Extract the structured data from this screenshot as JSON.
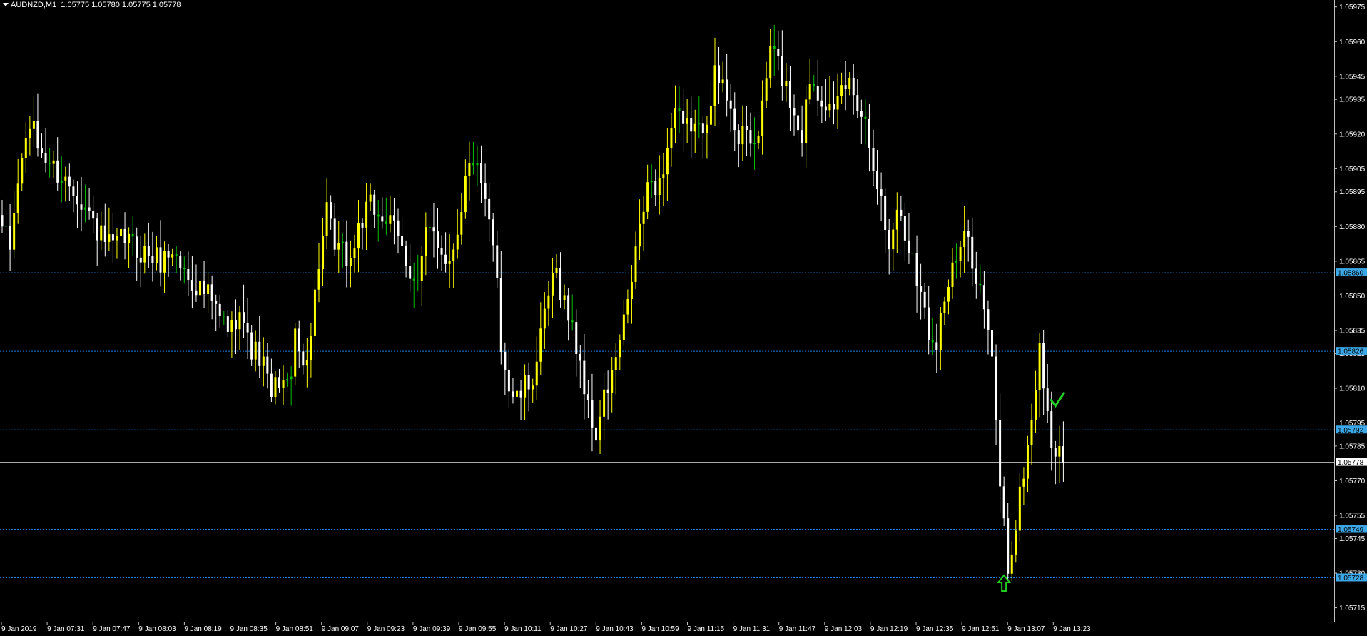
{
  "header": {
    "symbol": "AUDNZD,M1",
    "ohlc": "1.05775 1.05780 1.05775 1.05778"
  },
  "colors": {
    "background": "#000000",
    "bull": "#ffff00",
    "bear": "#ffffff",
    "doji": "#00c000",
    "axis": "#c0c0c0",
    "level_line": "#1e90ff",
    "level_tag": "#3ba7e6",
    "bid_line": "#c0c0c0",
    "annotation": "#22cc22"
  },
  "chart_data": {
    "type": "candlestick",
    "title": "AUDNZD,M1",
    "ylim": [
      1.05709,
      1.05978
    ],
    "y_ticks": [
      "1.05975",
      "1.05960",
      "1.05945",
      "1.05935",
      "1.05920",
      "1.05905",
      "1.05895",
      "1.05880",
      "1.05865",
      "1.05850",
      "1.05835",
      "1.05825",
      "1.05810",
      "1.05795",
      "1.05785",
      "1.05770",
      "1.05755",
      "1.05745",
      "1.05730",
      "1.05715"
    ],
    "x_ticks": [
      "9 Jan 2019",
      "9 Jan 07:31",
      "9 Jan 07:47",
      "9 Jan 08:03",
      "9 Jan 08:19",
      "9 Jan 08:35",
      "9 Jan 08:51",
      "9 Jan 09:07",
      "9 Jan 09:23",
      "9 Jan 09:39",
      "9 Jan 09:55",
      "9 Jan 10:11",
      "9 Jan 10:27",
      "9 Jan 10:43",
      "9 Jan 10:59",
      "9 Jan 11:15",
      "9 Jan 11:31",
      "9 Jan 11:47",
      "9 Jan 12:03",
      "9 Jan 12:19",
      "9 Jan 12:35",
      "9 Jan 12:51",
      "9 Jan 13:07",
      "9 Jan 13:23"
    ],
    "levels": [
      {
        "value": 1.0586,
        "label": "1.05860"
      },
      {
        "value": 1.05826,
        "label": "1.05826"
      },
      {
        "value": 1.05792,
        "label": "1.05792"
      },
      {
        "value": 1.05749,
        "label": "1.05749"
      },
      {
        "value": 1.05728,
        "label": "1.05728"
      }
    ],
    "bid": {
      "value": 1.05778,
      "label": "1.05778"
    },
    "close_path": [
      [
        0,
        1.0588
      ],
      [
        2,
        1.0587
      ],
      [
        4,
        1.059
      ],
      [
        7,
        1.05925
      ],
      [
        9,
        1.05915
      ],
      [
        11,
        1.0591
      ],
      [
        13,
        1.05905
      ],
      [
        16,
        1.059
      ],
      [
        19,
        1.05895
      ],
      [
        22,
        1.05885
      ],
      [
        25,
        1.05875
      ],
      [
        28,
        1.0587
      ],
      [
        31,
        1.05875
      ],
      [
        34,
        1.0587
      ],
      [
        37,
        1.05868
      ],
      [
        40,
        1.05865
      ],
      [
        43,
        1.0587
      ],
      [
        46,
        1.0586
      ],
      [
        49,
        1.05855
      ],
      [
        52,
        1.0585
      ],
      [
        55,
        1.0584
      ],
      [
        58,
        1.05835
      ],
      [
        60,
        1.05848
      ],
      [
        62,
        1.0583
      ],
      [
        64,
        1.05825
      ],
      [
        66,
        1.0582
      ],
      [
        68,
        1.05805
      ],
      [
        70,
        1.05815
      ],
      [
        72,
        1.0581
      ],
      [
        74,
        1.0583
      ],
      [
        76,
        1.0582
      ],
      [
        78,
        1.05835
      ],
      [
        80,
        1.05865
      ],
      [
        82,
        1.05885
      ],
      [
        84,
        1.0587
      ],
      [
        86,
        1.05868
      ],
      [
        88,
        1.05865
      ],
      [
        90,
        1.0588
      ],
      [
        93,
        1.05888
      ],
      [
        96,
        1.05885
      ],
      [
        99,
        1.05878
      ],
      [
        101,
        1.0587
      ],
      [
        103,
        1.05862
      ],
      [
        105,
        1.05855
      ],
      [
        107,
        1.05875
      ],
      [
        109,
        1.05878
      ],
      [
        111,
        1.0587
      ],
      [
        113,
        1.05865
      ],
      [
        115,
        1.0588
      ],
      [
        117,
        1.059
      ],
      [
        119,
        1.0591
      ],
      [
        121,
        1.05895
      ],
      [
        123,
        1.0588
      ],
      [
        125,
        1.0586
      ],
      [
        126,
        1.0583
      ],
      [
        128,
        1.0581
      ],
      [
        130,
        1.05805
      ],
      [
        132,
        1.0581
      ],
      [
        134,
        1.05815
      ],
      [
        136,
        1.0583
      ],
      [
        138,
        1.0585
      ],
      [
        140,
        1.0586
      ],
      [
        142,
        1.05848
      ],
      [
        144,
        1.05835
      ],
      [
        146,
        1.05822
      ],
      [
        148,
        1.058
      ],
      [
        150,
        1.0579
      ],
      [
        152,
        1.05805
      ],
      [
        154,
        1.05815
      ],
      [
        156,
        1.0583
      ],
      [
        158,
        1.05845
      ],
      [
        160,
        1.0587
      ],
      [
        162,
        1.05888
      ],
      [
        164,
        1.059
      ],
      [
        166,
        1.05898
      ],
      [
        168,
        1.05915
      ],
      [
        170,
        1.0593
      ],
      [
        172,
        1.0592
      ],
      [
        174,
        1.05925
      ],
      [
        176,
        1.0592
      ],
      [
        178,
        1.0593
      ],
      [
        180,
        1.05945
      ],
      [
        182,
        1.0594
      ],
      [
        184,
        1.05935
      ],
      [
        186,
        1.05915
      ],
      [
        188,
        1.0592
      ],
      [
        190,
        1.05915
      ],
      [
        192,
        1.0593
      ],
      [
        194,
        1.05958
      ],
      [
        196,
        1.0595
      ],
      [
        198,
        1.0594
      ],
      [
        200,
        1.0593
      ],
      [
        202,
        1.0592
      ],
      [
        204,
        1.05945
      ],
      [
        206,
        1.0594
      ],
      [
        208,
        1.05935
      ],
      [
        210,
        1.05925
      ],
      [
        212,
        1.0594
      ],
      [
        214,
        1.05942
      ],
      [
        216,
        1.05935
      ],
      [
        218,
        1.05925
      ],
      [
        220,
        1.0591
      ],
      [
        222,
        1.0589
      ],
      [
        224,
        1.0587
      ],
      [
        226,
        1.0589
      ],
      [
        228,
        1.05875
      ],
      [
        230,
        1.0587
      ],
      [
        232,
        1.0585
      ],
      [
        234,
        1.05835
      ],
      [
        236,
        1.05832
      ],
      [
        238,
        1.0585
      ],
      [
        240,
        1.0586
      ],
      [
        242,
        1.0587
      ],
      [
        244,
        1.05875
      ],
      [
        246,
        1.0586
      ],
      [
        248,
        1.05845
      ],
      [
        250,
        1.0582
      ],
      [
        252,
        1.0577
      ],
      [
        254,
        1.05732
      ],
      [
        256,
        1.0575
      ],
      [
        258,
        1.05775
      ],
      [
        260,
        1.05795
      ],
      [
        262,
        1.0583
      ],
      [
        264,
        1.05795
      ],
      [
        266,
        1.05782
      ],
      [
        268,
        1.05778
      ]
    ],
    "annotations": [
      {
        "type": "arrow-up",
        "bar": 253,
        "value": 1.05726
      },
      {
        "type": "check",
        "bar": 266,
        "value": 1.05803
      }
    ]
  }
}
